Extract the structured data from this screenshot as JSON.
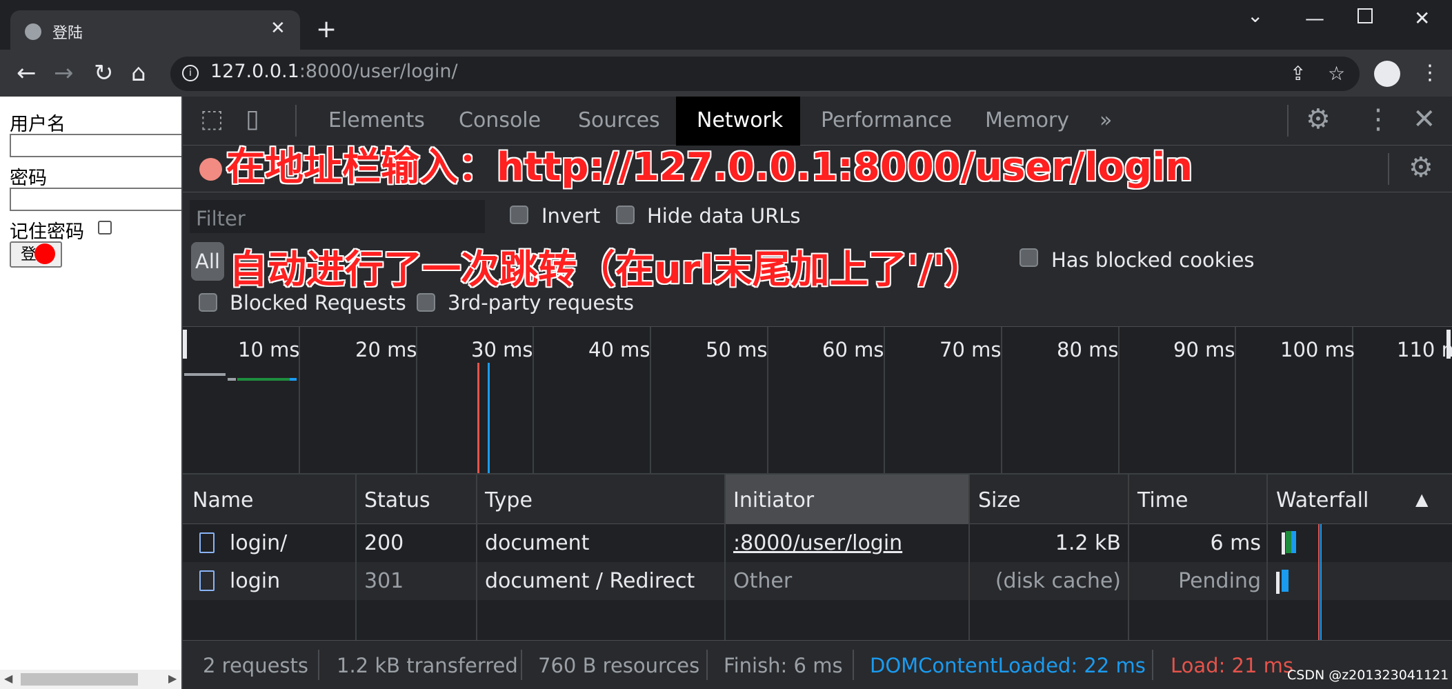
{
  "browser": {
    "tab_title": "登陆",
    "url_host": "127.0.0.1",
    "url_rest": ":8000/user/login/",
    "icons": [
      "globe-icon",
      "close-icon",
      "plus-icon",
      "back-icon",
      "forward-icon",
      "reload-icon",
      "home-icon",
      "share-icon",
      "star-icon",
      "profile-icon",
      "kebab-icon"
    ]
  },
  "page": {
    "username_label": "用户名",
    "password_label": "密码",
    "remember_label": "记住密码",
    "login_button": "登"
  },
  "devtools": {
    "tabs": [
      "Elements",
      "Console",
      "Sources",
      "Network",
      "Performance",
      "Memory"
    ],
    "active_tab": "Network",
    "more_tabs": "»",
    "filter_placeholder": "Filter",
    "invert_label": "Invert",
    "hide_data_urls_label": "Hide data URLs",
    "all_label": "All",
    "has_blocked_cookies_label": "Has blocked cookies",
    "blocked_requests_label": "Blocked Requests",
    "third_party_label": "3rd-party requests",
    "timeline_ticks": [
      "10 ms",
      "20 ms",
      "30 ms",
      "40 ms",
      "50 ms",
      "60 ms",
      "70 ms",
      "80 ms",
      "90 ms",
      "100 ms",
      "110 ms"
    ],
    "columns": [
      "Name",
      "Status",
      "Type",
      "Initiator",
      "Size",
      "Time",
      "Waterfall"
    ],
    "rows": [
      {
        "name": "login/",
        "status": "200",
        "type": "document",
        "initiator": ":8000/user/login",
        "size": "1.2 kB",
        "time": "6 ms"
      },
      {
        "name": "login",
        "status": "301",
        "type": "document / Redirect",
        "initiator": "Other",
        "size": "(disk cache)",
        "time": "Pending"
      }
    ],
    "status": {
      "requests": "2 requests",
      "transferred": "1.2 kB transferred",
      "resources": "760 B resources",
      "finish": "Finish: 6 ms",
      "dom_content_loaded": "DOMContentLoaded: 22 ms",
      "load": "Load: 21 ms"
    },
    "colors": {
      "dcl": "#1a9bf0",
      "load": "#f28b82",
      "accent": "#8ab4f8"
    }
  },
  "annotations": {
    "line1": "在地址栏输入：http://127.0.0.1:8000/user/login",
    "line2": "自动进行了一次跳转（在url末尾加上了'/'）"
  },
  "watermark": "CSDN @z201323041121"
}
